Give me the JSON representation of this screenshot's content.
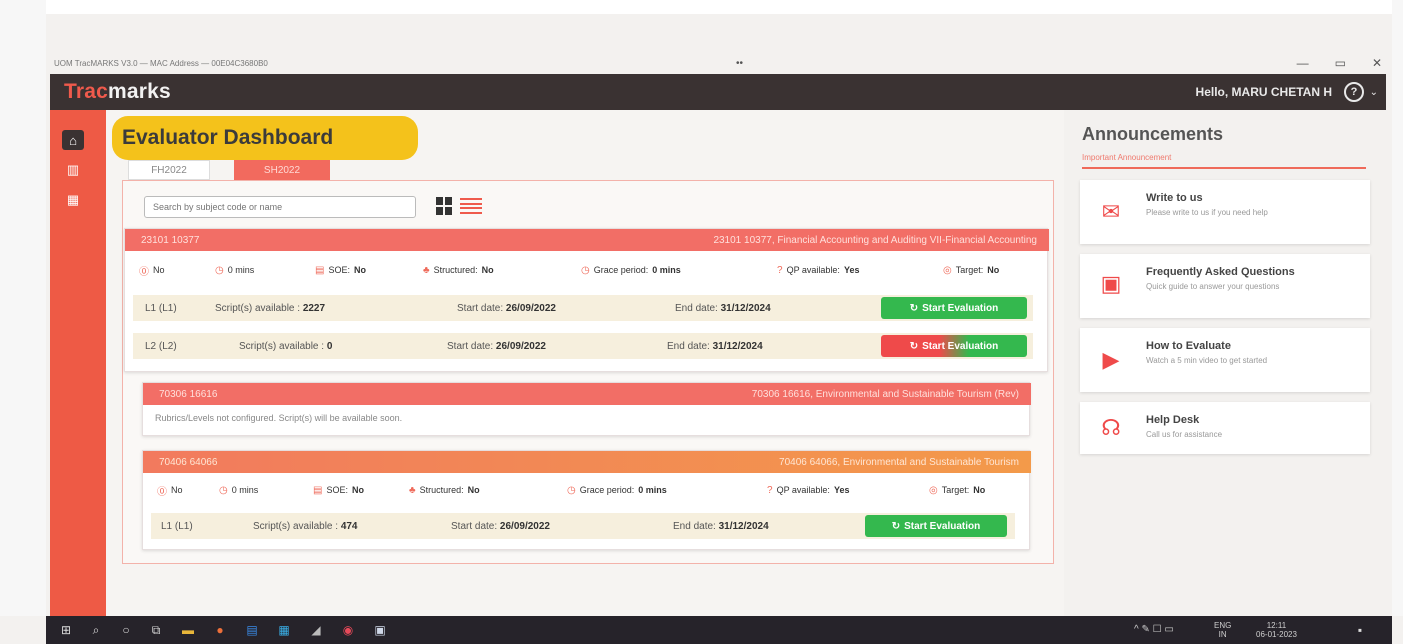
{
  "window": {
    "title": "UOM TracMARKS V3.0 — MAC Address — 00E04C3680B0",
    "dots": "••",
    "controls": [
      "—",
      "▭",
      "✕"
    ]
  },
  "header": {
    "logo_part1": "Trac",
    "logo_part2": "marks",
    "greeting": "Hello, MARU CHETAN H",
    "user_icon": "user-circle-icon"
  },
  "sidebar": {
    "items": [
      {
        "icon": "home-icon",
        "active": true
      },
      {
        "icon": "chart-icon",
        "active": false
      },
      {
        "icon": "grid-icon",
        "active": false
      }
    ]
  },
  "dashboard": {
    "title": "Evaluator Dashboard",
    "tabs": [
      "FH2022",
      "SH2022"
    ],
    "search_placeholder": "Search by subject code or name"
  },
  "courses": [
    {
      "code": "23101 10377",
      "name": "23101 10377, Financial Accounting and Auditing VII-Financial Accounting",
      "meta": {
        "optional_label": "No",
        "time_value": "0 mins",
        "soe_label": "SOE:",
        "soe_value": "No",
        "structured_label": "Structured:",
        "structured_value": "No",
        "grace_label": "Grace period:",
        "grace_value": "0 mins",
        "qp_label": "QP available:",
        "qp_value": "Yes",
        "target_label": "Target:",
        "target_value": "No"
      },
      "levels": [
        {
          "level": "L1 (L1)",
          "scripts_label": "Script(s) available :",
          "scripts": "2227",
          "start_label": "Start date:",
          "start": "26/09/2022",
          "end_label": "End date:",
          "end": "31/12/2024",
          "button": "Start Evaluation"
        },
        {
          "level": "L2 (L2)",
          "scripts_label": "Script(s) available :",
          "scripts": "0",
          "start_label": "Start date:",
          "start": "26/09/2022",
          "end_label": "End date:",
          "end": "31/12/2024",
          "button": "Start Evaluation"
        }
      ]
    },
    {
      "code": "70306 16616",
      "name": "70306 16616, Environmental and Sustainable Tourism (Rev)",
      "notice": "Rubrics/Levels not configured. Script(s) will be available soon."
    },
    {
      "code": "70406 64066",
      "name": "70406 64066, Environmental and Sustainable Tourism",
      "meta": {
        "optional_label": "No",
        "time_value": "0 mins",
        "soe_label": "SOE:",
        "soe_value": "No",
        "structured_label": "Structured:",
        "structured_value": "No",
        "grace_label": "Grace period:",
        "grace_value": "0 mins",
        "qp_label": "QP available:",
        "qp_value": "Yes",
        "target_label": "Target:",
        "target_value": "No"
      },
      "levels": [
        {
          "level": "L1 (L1)",
          "scripts_label": "Script(s) available :",
          "scripts": "474",
          "start_label": "Start date:",
          "start": "26/09/2022",
          "end_label": "End date:",
          "end": "31/12/2024",
          "button": "Start Evaluation"
        }
      ]
    }
  ],
  "announcements": {
    "title": "Announcements",
    "subtitle": "Important Announcement",
    "items": [
      {
        "icon": "envelope-icon",
        "title": "Write to us",
        "desc": "Please write to us if you need help"
      },
      {
        "icon": "faq-icon",
        "title": "Frequently Asked Questions",
        "desc": "Quick guide to answer your questions"
      },
      {
        "icon": "video-icon",
        "title": "How to Evaluate",
        "desc": "Watch a 5 min video to get started"
      },
      {
        "icon": "headset-icon",
        "title": "Help Desk",
        "desc": "Call us for assistance"
      }
    ]
  },
  "taskbar": {
    "lang": "ENG",
    "lang_sub": "IN",
    "time": "12:11",
    "date": "06-01-2023"
  },
  "colors": {
    "accent": "#ef5a45",
    "highlight": "#f4c21b",
    "success": "#34b84e",
    "dark": "#3a3232"
  }
}
